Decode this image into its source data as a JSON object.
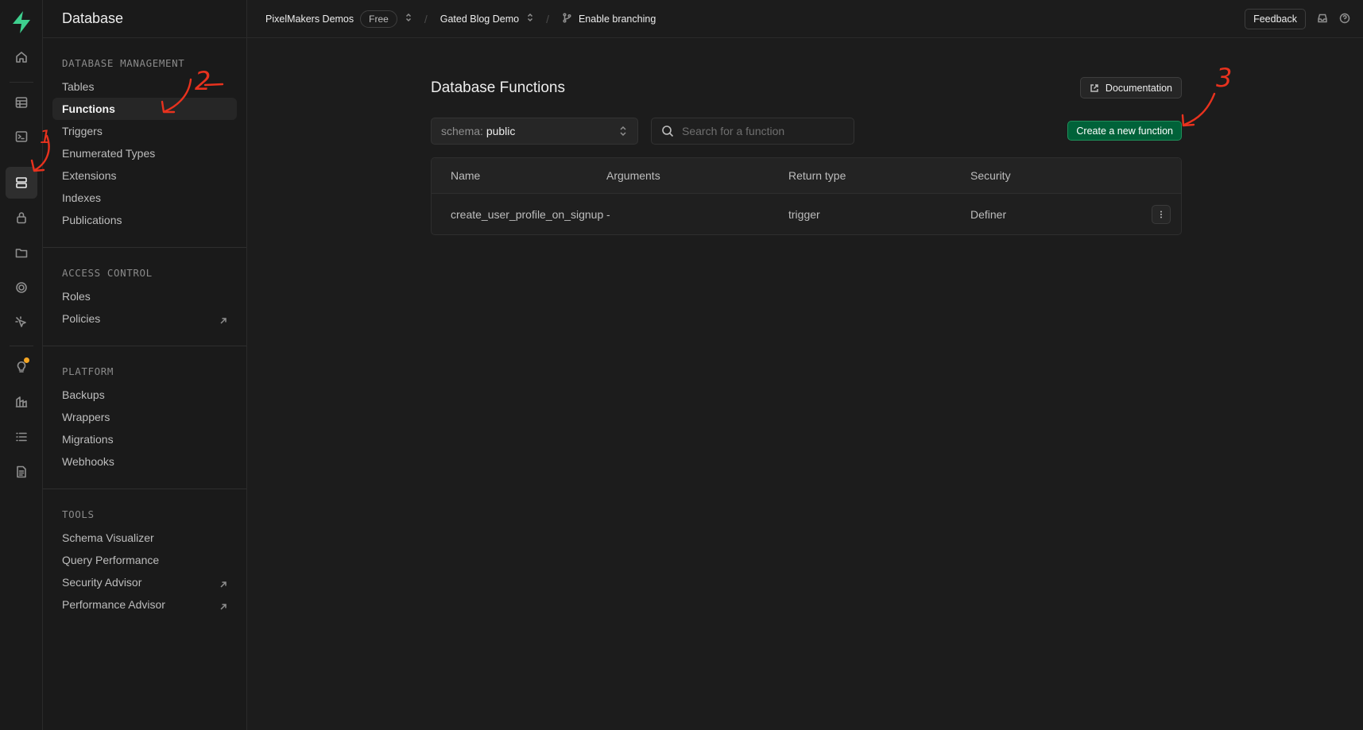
{
  "sidebar": {
    "title": "Database",
    "sections": [
      {
        "heading": "DATABASE MANAGEMENT",
        "items": [
          "Tables",
          "Functions",
          "Triggers",
          "Enumerated Types",
          "Extensions",
          "Indexes",
          "Publications"
        ]
      },
      {
        "heading": "ACCESS CONTROL",
        "items": [
          "Roles",
          "Policies"
        ]
      },
      {
        "heading": "PLATFORM",
        "items": [
          "Backups",
          "Wrappers",
          "Migrations",
          "Webhooks"
        ]
      },
      {
        "heading": "TOOLS",
        "items": [
          "Schema Visualizer",
          "Query Performance",
          "Security Advisor",
          "Performance Advisor"
        ]
      }
    ]
  },
  "rail": {
    "icons": [
      "home-icon",
      "table-editor-icon",
      "sql-editor-icon",
      "database-icon",
      "auth-icon",
      "storage-icon",
      "realtime-icon",
      "edge-functions-icon",
      "advisors-icon",
      "reports-icon",
      "logs-icon",
      "api-docs-icon"
    ]
  },
  "topbar": {
    "org": "PixelMakers Demos",
    "plan": "Free",
    "project": "Gated Blog Demo",
    "branching": "Enable branching",
    "feedback": "Feedback"
  },
  "main": {
    "title": "Database Functions",
    "doc_label": "Documentation",
    "schema_label": "schema:",
    "schema_value": "public",
    "search_placeholder": "Search for a function",
    "create_label": "Create a new function",
    "table": {
      "columns": [
        "Name",
        "Arguments",
        "Return type",
        "Security"
      ],
      "rows": [
        [
          "create_user_profile_on_signup",
          "-",
          "trigger",
          "Definer"
        ]
      ]
    }
  },
  "annotations": [
    "1",
    "2",
    "3"
  ],
  "colors": {
    "accent": "#3ecf8e",
    "primary_button": "#006239",
    "annotation": "#e8321e"
  }
}
